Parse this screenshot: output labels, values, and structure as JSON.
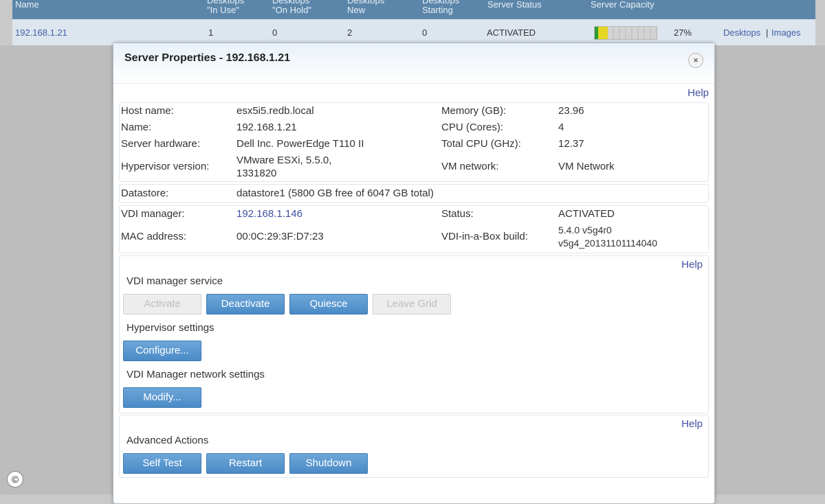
{
  "table": {
    "headers": [
      {
        "l1": "Name",
        "l2": ""
      },
      {
        "l1": "Desktops",
        "l2": "\"In Use\""
      },
      {
        "l1": "Desktops",
        "l2": "\"On Hold\""
      },
      {
        "l1": "Desktops",
        "l2": "New"
      },
      {
        "l1": "Desktops",
        "l2": "Starting"
      },
      {
        "l1": "Server Status",
        "l2": ""
      },
      {
        "l1": "Server Capacity",
        "l2": ""
      }
    ],
    "row": {
      "name": "192.168.1.21",
      "in_use": "1",
      "on_hold": "0",
      "new": "2",
      "starting": "0",
      "status": "ACTIVATED",
      "capacity_pct": "27%",
      "capacity_value": 0.27,
      "link_desktops": "Desktops",
      "link_sep": "|",
      "link_images": "Images"
    }
  },
  "dialog": {
    "title": "Server Properties - 192.168.1.21",
    "close_glyph": "×",
    "help": "Help",
    "info": {
      "host_name_label": "Host name:",
      "host_name": "esx5i5.redb.local",
      "name_label": "Name:",
      "name": "192.168.1.21",
      "hardware_label": "Server hardware:",
      "hardware": "Dell Inc. PowerEdge T110 II",
      "hypervisor_label": "Hypervisor version:",
      "hypervisor_l1": "VMware ESXi, 5.5.0,",
      "hypervisor_l2": "1331820",
      "memory_label": "Memory (GB):",
      "memory": "23.96",
      "cpu_label": "CPU (Cores):",
      "cpu": "4",
      "total_cpu_label": "Total CPU (GHz):",
      "total_cpu": "12.37",
      "vm_network_label": "VM network:",
      "vm_network": "VM Network"
    },
    "datastore": {
      "label": "Datastore:",
      "value": "datastore1 (5800 GB free of 6047 GB total)"
    },
    "manager": {
      "vdi_manager_label": "VDI manager:",
      "vdi_manager": "192.168.1.146",
      "mac_label": "MAC address:",
      "mac": "00:0C:29:3F:D7:23",
      "status_label": "Status:",
      "status": "ACTIVATED",
      "build_label": "VDI-in-a-Box build:",
      "build_l1": "5.4.0 v5g4r0",
      "build_l2": "v5g4_20131101114040"
    },
    "service": {
      "title": "VDI manager service",
      "activate": "Activate",
      "deactivate": "Deactivate",
      "quiesce": "Quiesce",
      "leave_grid": "Leave Grid",
      "hypervisor_title": "Hypervisor settings",
      "configure": "Configure...",
      "network_title": "VDI Manager network settings",
      "modify": "Modify..."
    },
    "advanced": {
      "title": "Advanced Actions",
      "self_test": "Self Test",
      "restart": "Restart",
      "shutdown": "Shutdown"
    }
  },
  "copyright": "©"
}
